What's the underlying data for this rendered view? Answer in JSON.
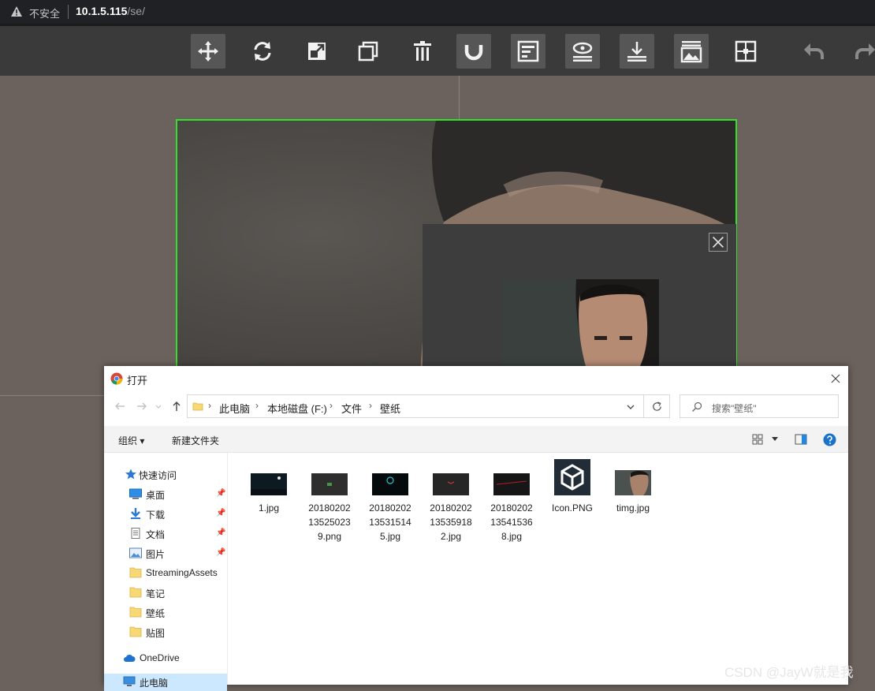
{
  "browser": {
    "security_label": "不安全",
    "url_host": "10.1.5.115",
    "url_path": "/se/"
  },
  "toolbar": {
    "tools": [
      {
        "name": "move",
        "icon": "move-icon"
      },
      {
        "name": "rotate",
        "icon": "rotate-icon"
      },
      {
        "name": "scale",
        "icon": "scale-icon"
      },
      {
        "name": "duplicate",
        "icon": "copy-icon"
      },
      {
        "name": "delete",
        "icon": "trash-icon"
      },
      {
        "name": "magnet",
        "icon": "magnet-icon"
      },
      {
        "name": "align",
        "icon": "align-icon"
      },
      {
        "name": "eye",
        "icon": "view-icon"
      },
      {
        "name": "download",
        "icon": "download-icon"
      },
      {
        "name": "image",
        "icon": "image-icon"
      },
      {
        "name": "grid",
        "icon": "grid-icon"
      },
      {
        "name": "undo",
        "icon": "undo-icon"
      },
      {
        "name": "redo",
        "icon": "redo-icon"
      }
    ]
  },
  "dialog": {
    "title": "打开",
    "breadcrumb": [
      "此电脑",
      "本地磁盘 (F:)",
      "文件",
      "壁纸"
    ],
    "search_placeholder": "搜索\"壁纸\"",
    "commands": {
      "organize": "组织 ▾",
      "new_folder": "新建文件夹"
    },
    "sidebar": [
      {
        "label": "快速访问",
        "icon": "star-icon",
        "pinned": false
      },
      {
        "label": "桌面",
        "icon": "desktop-icon",
        "pinned": true
      },
      {
        "label": "下载",
        "icon": "download-arrow-icon",
        "pinned": true
      },
      {
        "label": "文档",
        "icon": "document-icon",
        "pinned": true
      },
      {
        "label": "图片",
        "icon": "pictures-icon",
        "pinned": true
      },
      {
        "label": "StreamingAssets",
        "icon": "folder-icon",
        "pinned": false
      },
      {
        "label": "笔记",
        "icon": "folder-icon",
        "pinned": false
      },
      {
        "label": "壁纸",
        "icon": "folder-icon",
        "pinned": false
      },
      {
        "label": "贴图",
        "icon": "folder-icon",
        "pinned": false
      },
      {
        "label": "OneDrive",
        "icon": "cloud-icon",
        "pinned": false
      },
      {
        "label": "此电脑",
        "icon": "computer-icon",
        "pinned": false
      }
    ],
    "files": [
      {
        "name": "1.jpg"
      },
      {
        "name": "20180202\n13525023\n9.png"
      },
      {
        "name": "20180202\n13531514\n5.jpg"
      },
      {
        "name": "20180202\n13535918\n2.jpg"
      },
      {
        "name": "20180202\n13541536\n8.jpg"
      },
      {
        "name": "Icon.PNG"
      },
      {
        "name": "timg.jpg"
      }
    ]
  },
  "watermark": "CSDN @JayW就是我"
}
